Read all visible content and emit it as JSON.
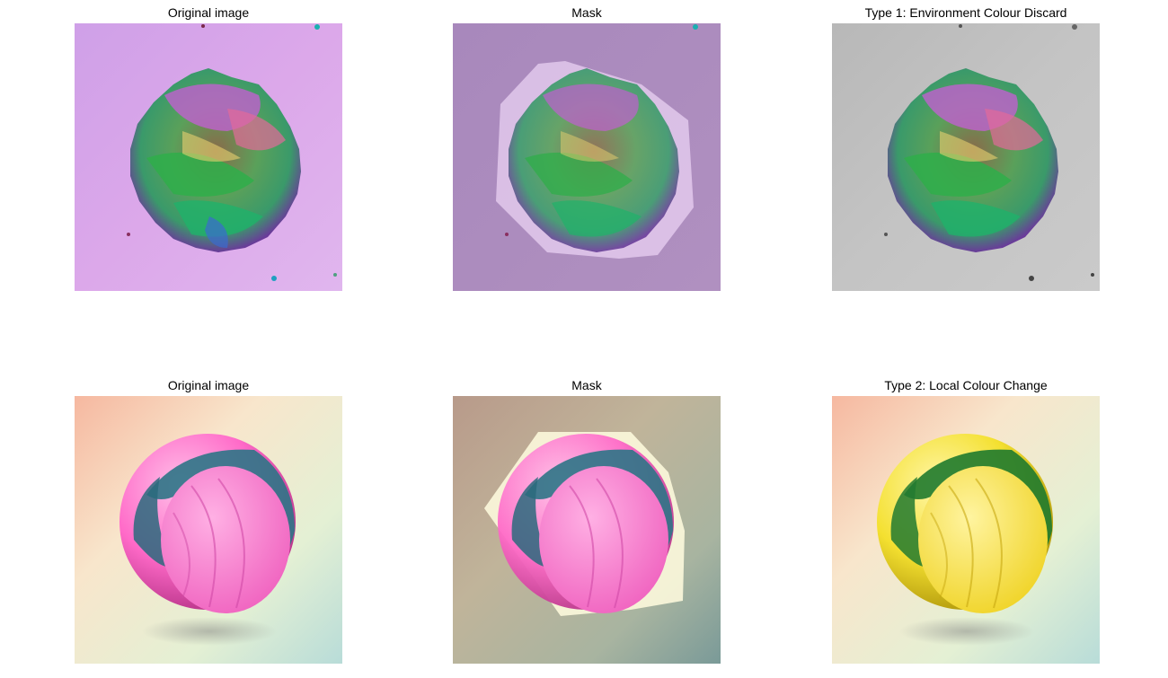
{
  "figure": {
    "row1": {
      "original_title": "Original image",
      "mask_title": "Mask",
      "result_title": "Type 1: Environment Colour Discard"
    },
    "row2": {
      "original_title": "Original image",
      "mask_title": "Mask",
      "result_title": "Type 2: Local Colour Change"
    }
  },
  "colors": {
    "row1_background": "#d8a8ec",
    "row1_mask_background": "#ae84be",
    "row1_mask_overlay": "#f0d8f8",
    "row1_gray_background": "#bdbdbd",
    "row2_background": "#f6e4c8",
    "row2_mask_background": "#b8ab98",
    "row2_mask_overlay": "#fbf6dc",
    "pink": "#ff7ad0",
    "teal": "#2e7c8c",
    "yellow": "#f4e23a",
    "green": "#1f8a2e"
  }
}
